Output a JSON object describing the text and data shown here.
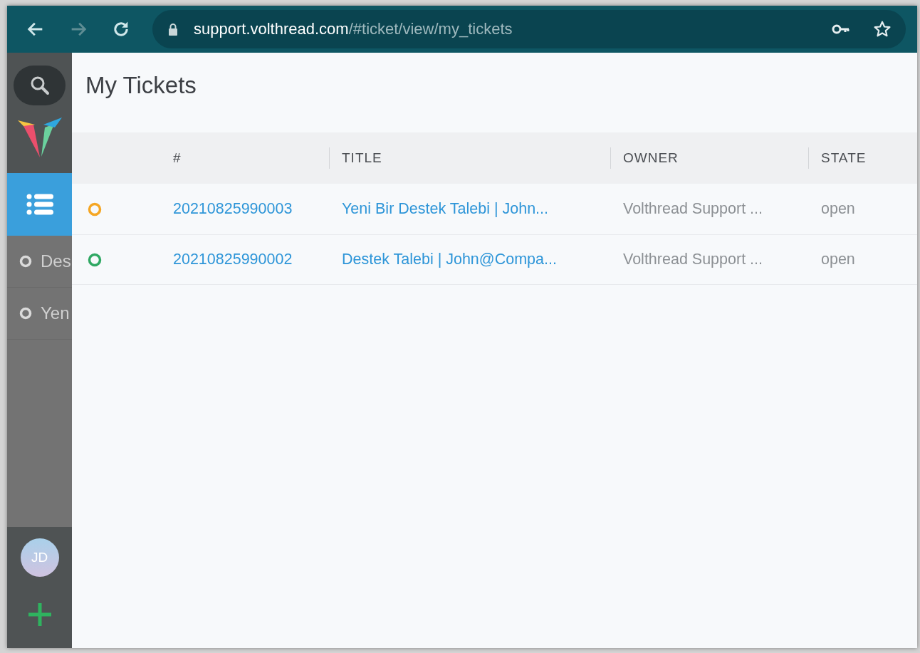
{
  "browser": {
    "back_disabled": false,
    "forward_disabled": true,
    "address": {
      "host": "support.volthread.com",
      "path": "/#ticket/view/my_tickets"
    }
  },
  "sidebar": {
    "items": [
      {
        "label": "Des"
      },
      {
        "label": "Yen"
      }
    ],
    "avatar": "JD"
  },
  "page": {
    "title": "My Tickets"
  },
  "table": {
    "columns": [
      "#",
      "TITLE",
      "OWNER",
      "STATE"
    ],
    "rows": [
      {
        "color": "#f5a623",
        "number": "20210825990003",
        "title": "Yeni Bir Destek Talebi | John...",
        "owner": "Volthread Support ...",
        "state": "open"
      },
      {
        "color": "#2fa863",
        "number": "20210825990002",
        "title": "Destek Talebi | John@Compa...",
        "owner": "Volthread Support ...",
        "state": "open"
      }
    ]
  }
}
